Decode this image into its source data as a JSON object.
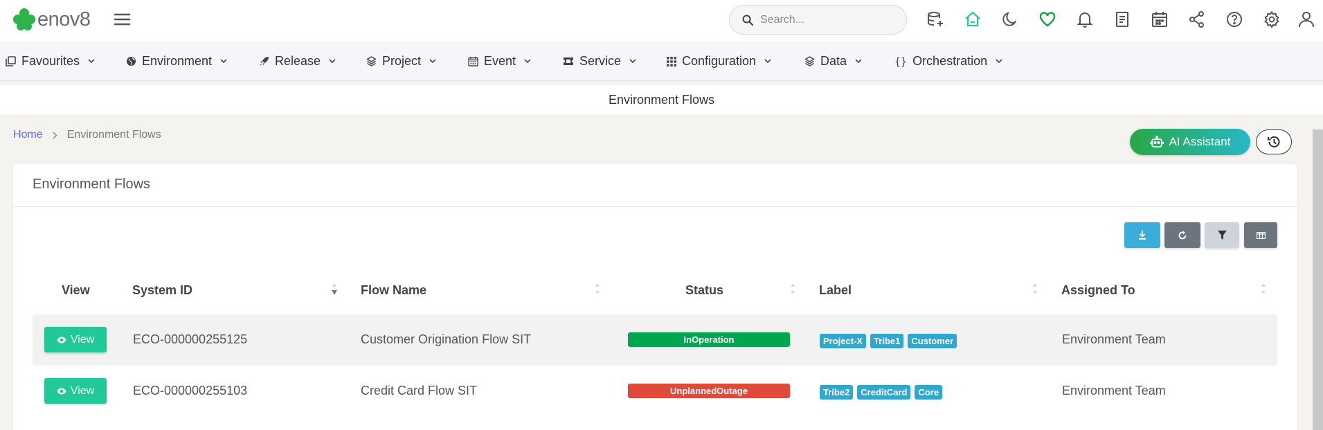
{
  "app": {
    "logo_text": "enov8"
  },
  "search": {
    "placeholder": "Search..."
  },
  "topbar_icons": [
    "database-add-icon",
    "home-icon",
    "moon-icon",
    "heart-icon",
    "bell-icon",
    "document-icon",
    "calendar-icon",
    "share-icon",
    "help-icon",
    "settings-icon",
    "user-icon"
  ],
  "nav": {
    "items": [
      {
        "label": "Favourites",
        "icon": "favourites-icon"
      },
      {
        "label": "Environment",
        "icon": "globe-icon"
      },
      {
        "label": "Release",
        "icon": "rocket-icon"
      },
      {
        "label": "Project",
        "icon": "layers-icon"
      },
      {
        "label": "Event",
        "icon": "calendar-icon"
      },
      {
        "label": "Service",
        "icon": "ticket-icon"
      },
      {
        "label": "Configuration",
        "icon": "grid-icon"
      },
      {
        "label": "Data",
        "icon": "layers-icon"
      },
      {
        "label": "Orchestration",
        "icon": "braces-icon"
      }
    ]
  },
  "page": {
    "title": "Environment Flows"
  },
  "breadcrumb": {
    "home": "Home",
    "current": "Environment Flows"
  },
  "actions": {
    "ai_assistant": "AI Assistant"
  },
  "card": {
    "title": "Environment Flows"
  },
  "colors": {
    "accent": "#20c997",
    "in_operation": "#00a650",
    "unplanned_outage": "#e04a3a",
    "tag": "#2fa8d0",
    "download": "#3aaed8",
    "refresh": "#6c757d",
    "filter": "#ced4da",
    "columns": "#6c757d"
  },
  "table": {
    "columns": [
      "View",
      "System ID",
      "Flow Name",
      "Status",
      "Label",
      "Assigned To"
    ],
    "view_label": "View",
    "rows": [
      {
        "system_id": "ECO-000000255125",
        "flow_name": "Customer Origination Flow SIT",
        "status": "InOperation",
        "labels": [
          "Project-X",
          "Tribe1",
          "Customer"
        ],
        "assigned_to": "Environment Team"
      },
      {
        "system_id": "ECO-000000255103",
        "flow_name": "Credit Card Flow SIT",
        "status": "UnplannedOutage",
        "labels": [
          "Tribe2",
          "CreditCard",
          "Core"
        ],
        "assigned_to": "Environment Team"
      }
    ]
  }
}
